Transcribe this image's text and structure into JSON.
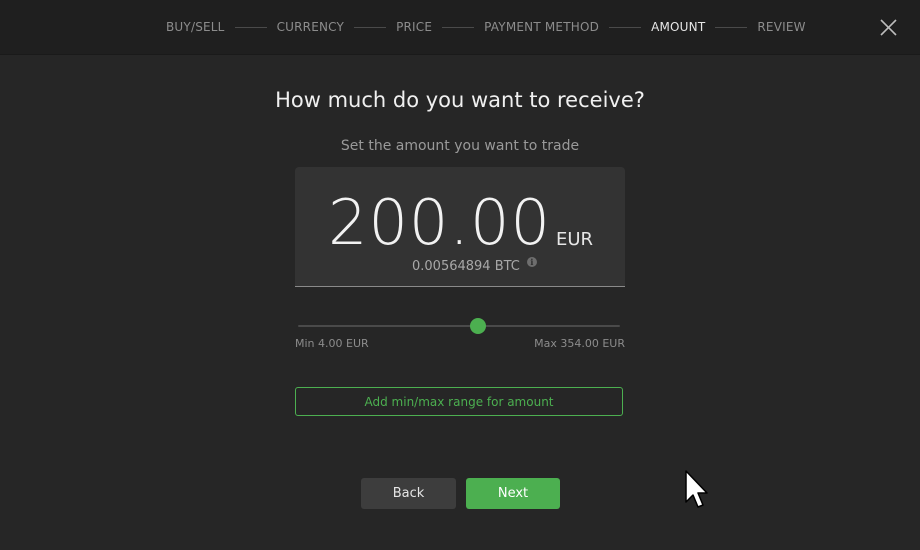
{
  "steps": [
    {
      "label": "BUY/SELL",
      "active": false
    },
    {
      "label": "CURRENCY",
      "active": false
    },
    {
      "label": "PRICE",
      "active": false
    },
    {
      "label": "PAYMENT METHOD",
      "active": false
    },
    {
      "label": "AMOUNT",
      "active": true
    },
    {
      "label": "REVIEW",
      "active": false
    }
  ],
  "header": {
    "close_icon": "close-icon"
  },
  "main": {
    "title": "How much do you want to receive?",
    "subtitle": "Set the amount you want to trade"
  },
  "amount": {
    "value": "200.00",
    "currency": "EUR",
    "crypto_equivalent": "0.00564894 BTC",
    "info_icon": "info-icon"
  },
  "slider": {
    "min": 4.0,
    "max": 354.0,
    "value": 200.0,
    "min_label": "Min 4.00 EUR",
    "max_label": "Max 354.00 EUR"
  },
  "range_button": {
    "label": "Add min/max range for amount"
  },
  "nav": {
    "back_label": "Back",
    "next_label": "Next"
  },
  "colors": {
    "accent": "#4caf50",
    "background": "#262626",
    "topbar": "#1f1f1f",
    "panel": "#333333"
  }
}
